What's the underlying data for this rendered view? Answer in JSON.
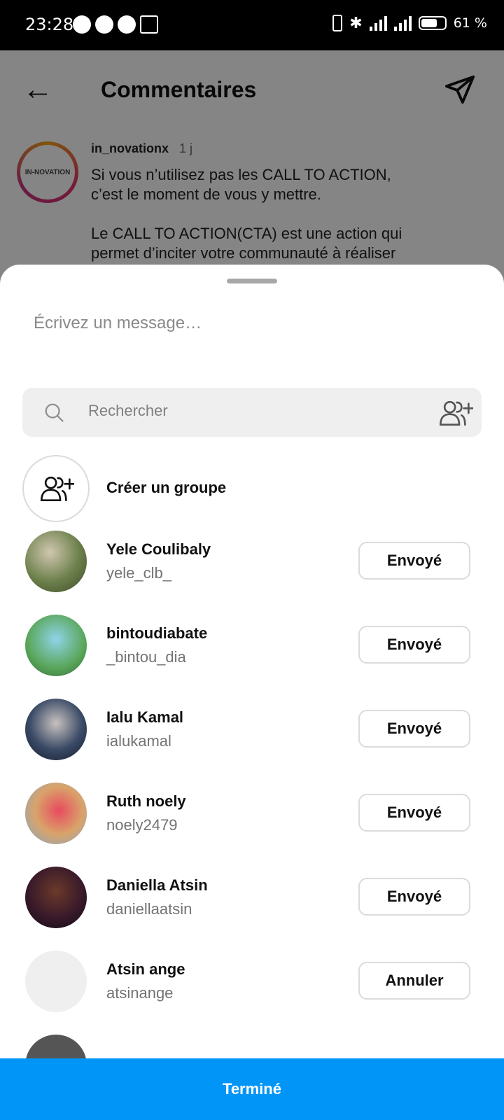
{
  "status_bar": {
    "time": "23:28",
    "battery": "61 %"
  },
  "header": {
    "title": "Commentaires"
  },
  "post": {
    "username": "in_novationx",
    "time": "1 j",
    "avatar_text": "IN-NOVATION",
    "text": "Si vous n’utilisez pas les CALL TO ACTION,\nc’est le moment de vous y mettre.\n\nLe CALL TO ACTION(CTA) est une action qui\npermet d’inciter votre communauté à réaliser"
  },
  "sheet": {
    "message_placeholder": "Écrivez un message…",
    "search_placeholder": "Rechercher",
    "create_group_label": "Créer un groupe",
    "contacts": [
      {
        "name": "Yele Coulibaly",
        "username": "yele_clb_",
        "button": "Envoyé"
      },
      {
        "name": "bintoudiabate",
        "username": "_bintou_dia",
        "button": "Envoyé"
      },
      {
        "name": "Ialu Kamal",
        "username": "ialukamal",
        "button": "Envoyé"
      },
      {
        "name": "Ruth noely",
        "username": "noely2479",
        "button": "Envoyé"
      },
      {
        "name": "Daniella Atsin",
        "username": "daniellaatsin",
        "button": "Envoyé"
      },
      {
        "name": "Atsin ange",
        "username": "atsinange",
        "button": "Annuler"
      }
    ],
    "done_label": "Terminé"
  },
  "colors": {
    "accent": "#0095f6",
    "dim_overlay": "rgba(0,0,0,0.48)"
  }
}
